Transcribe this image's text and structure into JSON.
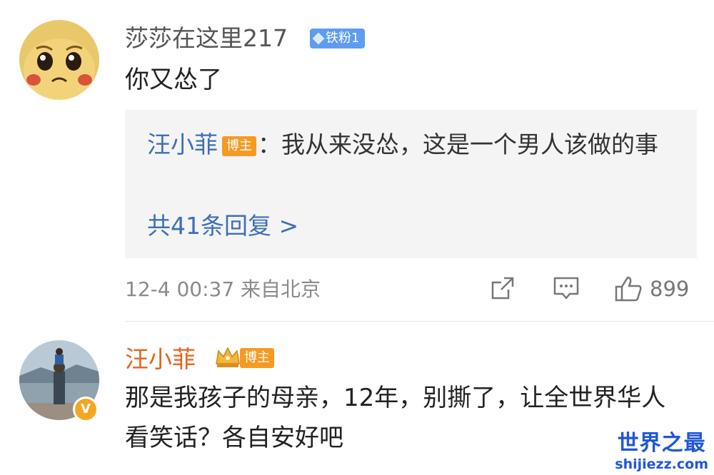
{
  "comment1": {
    "username": "莎莎在这里217",
    "fan_badge": "铁粉1",
    "text": "你又怂了",
    "reply": {
      "name": "汪小菲",
      "host_badge": "博主",
      "text": "：我从来没怂，这是一个男人该做的事",
      "more": "共41条回复 >"
    },
    "meta": "12-4 00:37 来自北京",
    "like_count": "899"
  },
  "comment2": {
    "username": "汪小菲",
    "host_badge": "博主",
    "verify": "V",
    "text": "那是我孩子的母亲，12年，别撕了，让全世界华人看笑话？各自安好吧"
  },
  "watermark": {
    "title": "世界之最",
    "site": "shijiezz.com"
  },
  "colors": {
    "link_blue": "#3d6fb6",
    "host_badge": "#f59a23",
    "fan_badge": "#5e9cf0",
    "watermark": "#1f57d6"
  },
  "icons": [
    "share-icon",
    "comment-icon",
    "like-icon",
    "crown-icon",
    "diamond-icon",
    "verified-icon"
  ]
}
